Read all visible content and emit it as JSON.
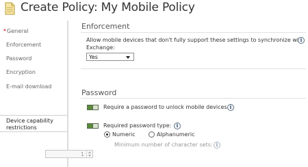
{
  "window": {
    "title": "Create Policy: My Mobile Policy",
    "icon": "document-icon"
  },
  "sidebar": {
    "items": [
      {
        "label": "General",
        "required_mark": "*"
      },
      {
        "label": "Enforcement"
      },
      {
        "label": "Password"
      },
      {
        "label": "Encryption"
      },
      {
        "label": "E-mail download"
      }
    ],
    "selected": {
      "line1": "Device capability",
      "line2": "restrictions"
    }
  },
  "enforcement": {
    "heading": "Enforcement",
    "description_line1": "Allow mobile devices that don't fully support these settings to synchronize with",
    "description_line2": "Exchange:",
    "dropdown_value": "Yes"
  },
  "password": {
    "heading": "Password",
    "require_password_label": "Require a password to unlock mobile devices:",
    "require_password_on": true,
    "required_type_label": "Required password type:",
    "required_type_on": true,
    "options": {
      "numeric": "Numeric",
      "alphanumeric": "Alphanumeric"
    },
    "selected_option": "Numeric",
    "min_char_sets_label": "Minimum number of character sets:",
    "min_char_sets_value": "1"
  },
  "colors": {
    "toggle_on": "#5a8a3a",
    "info_icon": "#1e3a5f",
    "required_mark": "#cc0000"
  }
}
